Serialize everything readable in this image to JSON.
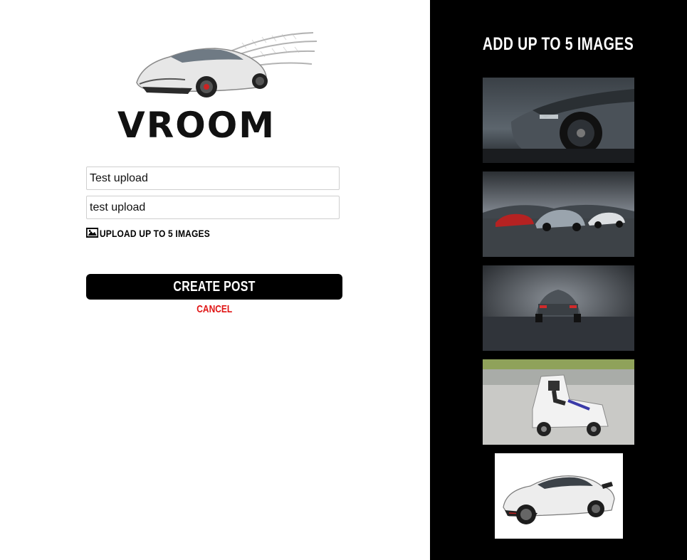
{
  "brand": {
    "name": "VROOM"
  },
  "form": {
    "title_value": "Test upload",
    "description_value": "test upload",
    "upload_label": "UPLOAD UP TO 5 IMAGES",
    "create_button": "CREATE POST",
    "cancel_link": "CANCEL"
  },
  "preview_panel": {
    "title": "ADD UP TO 5 IMAGES",
    "images": [
      {
        "subject": "grey hatchback front wheel close-up in storm"
      },
      {
        "subject": "three hatchbacks on wet track"
      },
      {
        "subject": "grey hatchback rear view on wet road"
      },
      {
        "subject": "person driving small white novelty vehicle"
      },
      {
        "subject": "white sports coupe on white background"
      }
    ]
  },
  "colors": {
    "panel_bg": "#000000",
    "accent_red": "#e01414",
    "button_bg": "#000000"
  }
}
